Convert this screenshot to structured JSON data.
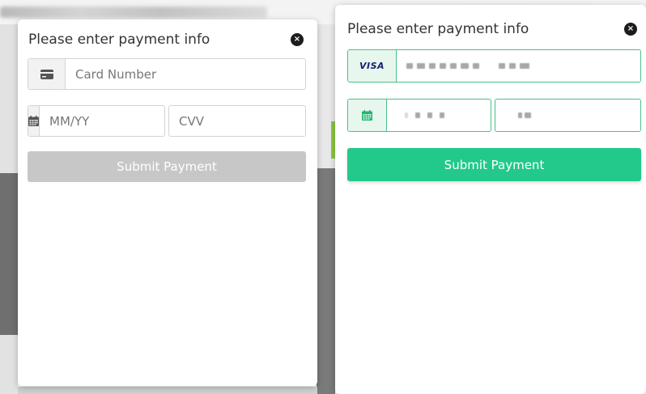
{
  "colors": {
    "accent_green": "#22c98a",
    "valid_border": "#49c08a",
    "disabled_button": "#c7c7c7",
    "visa_blue": "#1a1f71"
  },
  "left_modal": {
    "title": "Please enter payment info",
    "close_icon": "×",
    "card_number": {
      "placeholder": "Card Number",
      "icon": "credit-card-icon"
    },
    "expiry": {
      "placeholder": "MM/YY",
      "icon": "calendar-icon"
    },
    "cvv": {
      "placeholder": "CVV"
    },
    "submit_label": "Submit Payment",
    "submit_state": "disabled"
  },
  "right_modal": {
    "title": "Please enter payment info",
    "close_icon": "×",
    "card_number": {
      "brand": "VISA",
      "value_state": "filled-masked"
    },
    "expiry": {
      "icon": "calendar-icon",
      "value_state": "filled-masked"
    },
    "cvv": {
      "value_state": "filled-masked"
    },
    "submit_label": "Submit Payment",
    "submit_state": "enabled"
  }
}
